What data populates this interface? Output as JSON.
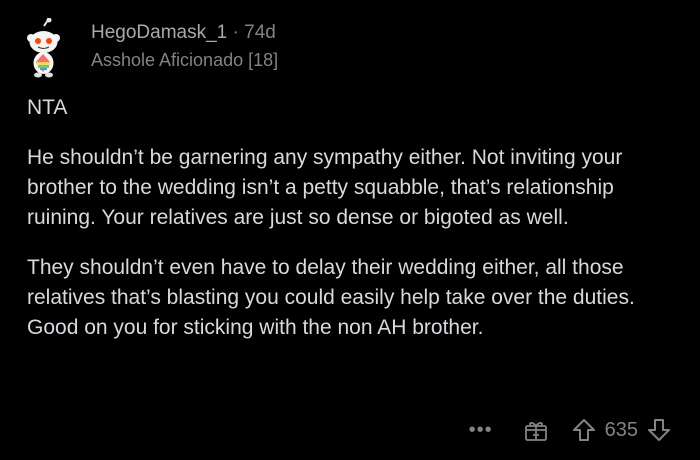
{
  "comment": {
    "author": "HegoDamask_1",
    "separator": "·",
    "age": "74d",
    "flair": "Asshole Aficionado [18]",
    "paragraphs": [
      "NTA",
      "He shouldn’t be garnering any sympathy either. Not inviting your brother to the wedding isn’t a petty squabble, that’s relationship ruining. Your relatives are just so dense or bigoted as well.",
      "They shouldn’t even have to delay their wedding either, all those relatives that’s blasting you could easily help take over the duties. Good on you for sticking with the non AH brother."
    ],
    "score": "635",
    "more_label": "•••"
  },
  "icons": {
    "avatar": "reddit-snoo-avatar-icon",
    "award": "gift-award-icon",
    "upvote": "arrow-up-icon",
    "downvote": "arrow-down-icon"
  },
  "colors": {
    "background": "#000000",
    "text": "#d7dadc",
    "meta": "#818384",
    "username": "#a7a9ab"
  }
}
